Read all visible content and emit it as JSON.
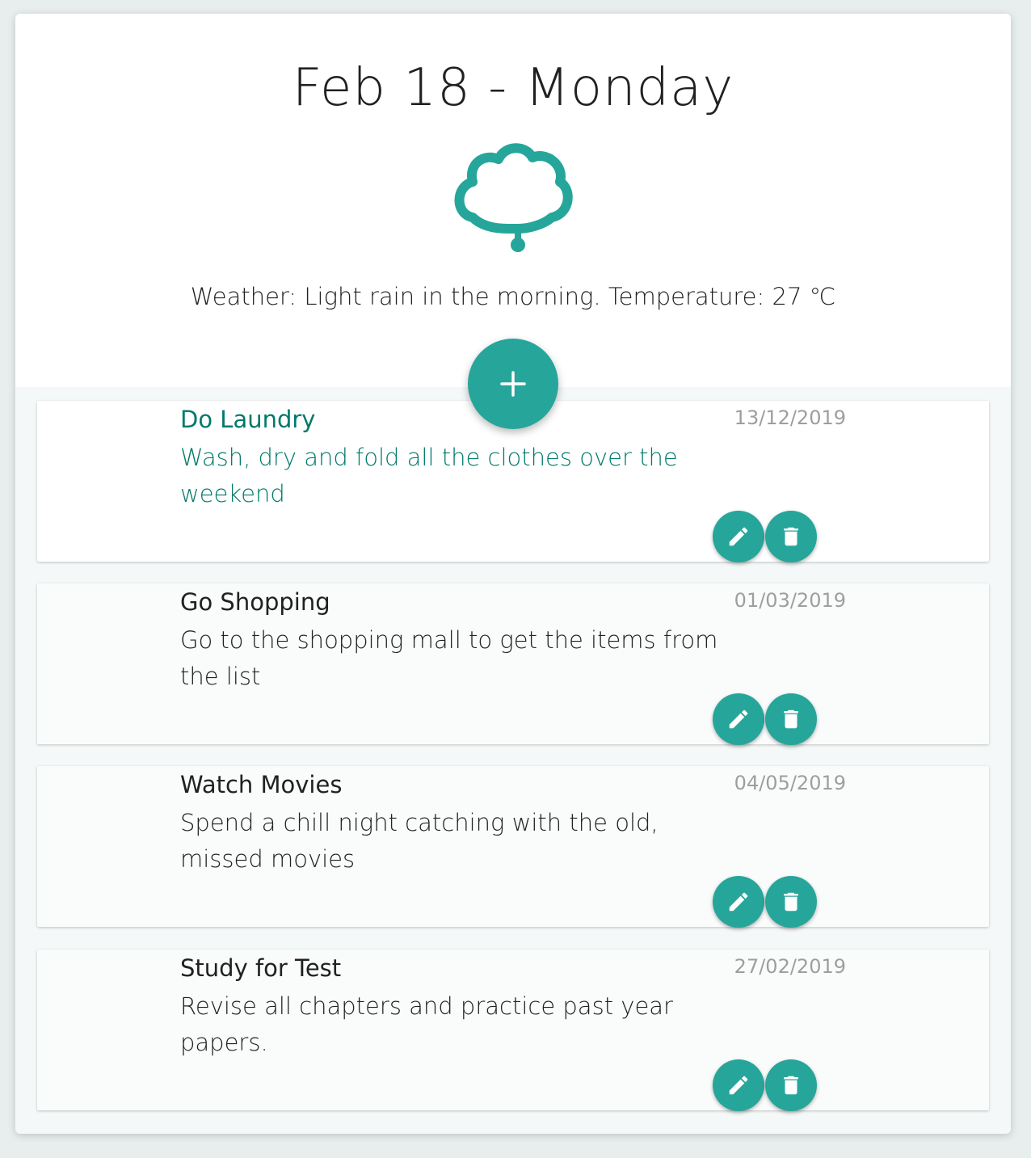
{
  "header": {
    "date_title": "Feb 18 - Monday",
    "weather_icon": "cloud-icon",
    "weather_text": "Weather: Light rain in the morning. Temperature: 27 ℃"
  },
  "add_button": {
    "icon": "plus-icon"
  },
  "colors": {
    "accent": "#26a69a",
    "active_text": "#00796b",
    "date_text": "#9e9e9e"
  },
  "tasks": [
    {
      "title": "Do Laundry",
      "description": "Wash, dry and fold all the clothes over the weekend",
      "date": "13/12/2019",
      "active": true
    },
    {
      "title": "Go Shopping",
      "description": "Go to the shopping mall to get the items from the list",
      "date": "01/03/2019",
      "active": false
    },
    {
      "title": "Watch Movies",
      "description": "Spend a chill night catching with the old, missed movies",
      "date": "04/05/2019",
      "active": false
    },
    {
      "title": "Study for Test",
      "description": "Revise all chapters and practice past year papers.",
      "date": "27/02/2019",
      "active": false
    }
  ],
  "task_actions": {
    "edit_icon": "pencil-icon",
    "delete_icon": "trash-icon"
  }
}
